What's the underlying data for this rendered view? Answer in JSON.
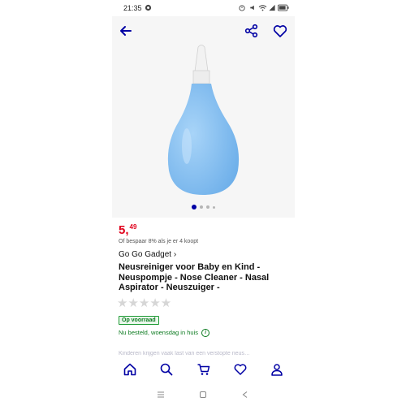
{
  "status_bar": {
    "time": "21:35"
  },
  "product": {
    "price_whole": "5,",
    "price_cents": "49",
    "bulk_discount": "Of bespaar 8% als je er 4 koopt",
    "seller": "Go Go Gadget ›",
    "title": "Neusreiniger voor Baby en Kind - Neuspompje - Nose Cleaner - Nasal Aspirator - Neuszuiger -",
    "rating_stars": "★★★★★",
    "rating_value": 0,
    "stock_label": "Op voorraad",
    "delivery_text": "Nu besteld, woensdag in huis",
    "description_preview": "Kinderen krijgen vaak last van een verstopte neus…"
  },
  "gallery": {
    "image_count": 4,
    "active_index": 0
  },
  "colors": {
    "accent": "#0000a4",
    "price": "#e0001b",
    "stock": "#0b7a1f",
    "product": "#8ec3f2"
  },
  "icons": {
    "back": "arrow-left-icon",
    "share": "share-icon",
    "favorite": "heart-icon",
    "home": "home-icon",
    "search": "search-icon",
    "cart": "cart-icon",
    "wishlist": "heart-icon",
    "account": "person-icon"
  }
}
